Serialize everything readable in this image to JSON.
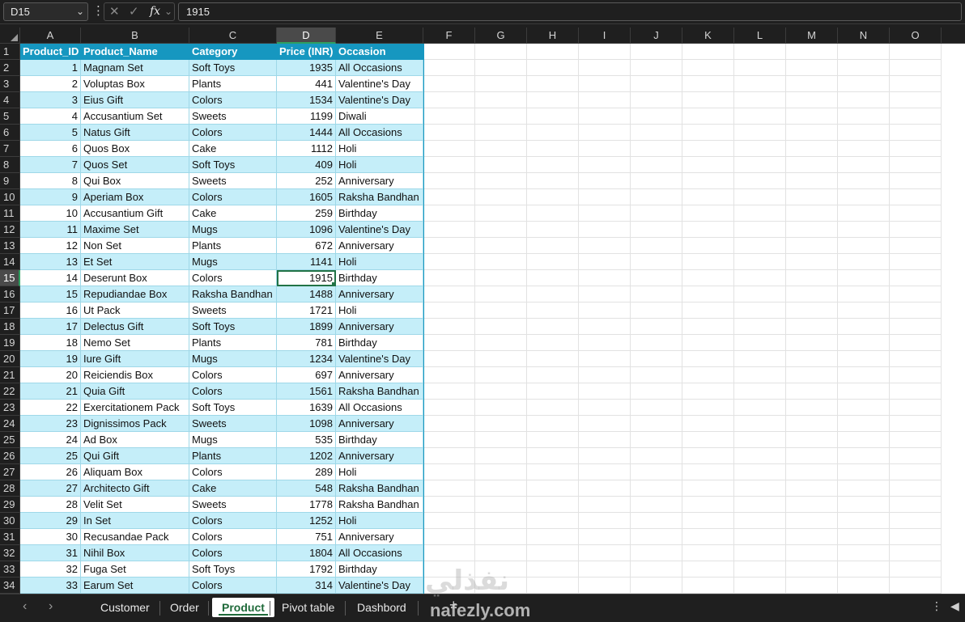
{
  "formula_bar": {
    "name_box": "D15",
    "formula": "1915"
  },
  "columns": [
    "A",
    "B",
    "C",
    "D",
    "E",
    "F",
    "G",
    "H",
    "I",
    "J",
    "K",
    "L",
    "M",
    "N",
    "O"
  ],
  "selected_column": "D",
  "selected_row": 15,
  "table": {
    "headers": [
      "Product_ID",
      "Product_Name",
      "Category",
      "Price (INR)",
      "Occasion"
    ],
    "rows": [
      [
        1,
        "Magnam Set",
        "Soft Toys",
        1935,
        "All Occasions"
      ],
      [
        2,
        "Voluptas Box",
        "Plants",
        441,
        "Valentine's Day"
      ],
      [
        3,
        "Eius Gift",
        "Colors",
        1534,
        "Valentine's Day"
      ],
      [
        4,
        "Accusantium Set",
        "Sweets",
        1199,
        "Diwali"
      ],
      [
        5,
        "Natus Gift",
        "Colors",
        1444,
        "All Occasions"
      ],
      [
        6,
        "Quos Box",
        "Cake",
        1112,
        "Holi"
      ],
      [
        7,
        "Quos Set",
        "Soft Toys",
        409,
        "Holi"
      ],
      [
        8,
        "Qui Box",
        "Sweets",
        252,
        "Anniversary"
      ],
      [
        9,
        "Aperiam Box",
        "Colors",
        1605,
        "Raksha Bandhan"
      ],
      [
        10,
        "Accusantium Gift",
        "Cake",
        259,
        "Birthday"
      ],
      [
        11,
        "Maxime Set",
        "Mugs",
        1096,
        "Valentine's Day"
      ],
      [
        12,
        "Non Set",
        "Plants",
        672,
        "Anniversary"
      ],
      [
        13,
        "Et Set",
        "Mugs",
        1141,
        "Holi"
      ],
      [
        14,
        "Deserunt Box",
        "Colors",
        1915,
        "Birthday"
      ],
      [
        15,
        "Repudiandae Box",
        "Raksha Bandhan",
        1488,
        "Anniversary"
      ],
      [
        16,
        "Ut Pack",
        "Sweets",
        1721,
        "Holi"
      ],
      [
        17,
        "Delectus Gift",
        "Soft Toys",
        1899,
        "Anniversary"
      ],
      [
        18,
        "Nemo Set",
        "Plants",
        781,
        "Birthday"
      ],
      [
        19,
        "Iure Gift",
        "Mugs",
        1234,
        "Valentine's Day"
      ],
      [
        20,
        "Reiciendis Box",
        "Colors",
        697,
        "Anniversary"
      ],
      [
        21,
        "Quia Gift",
        "Colors",
        1561,
        "Raksha Bandhan"
      ],
      [
        22,
        "Exercitationem Pack",
        "Soft Toys",
        1639,
        "All Occasions"
      ],
      [
        23,
        "Dignissimos Pack",
        "Sweets",
        1098,
        "Anniversary"
      ],
      [
        24,
        "Ad Box",
        "Mugs",
        535,
        "Birthday"
      ],
      [
        25,
        "Qui Gift",
        "Plants",
        1202,
        "Anniversary"
      ],
      [
        26,
        "Aliquam Box",
        "Colors",
        289,
        "Holi"
      ],
      [
        27,
        "Architecto Gift",
        "Cake",
        548,
        "Raksha Bandhan"
      ],
      [
        28,
        "Velit Set",
        "Sweets",
        1778,
        "Raksha Bandhan"
      ],
      [
        29,
        "In Set",
        "Colors",
        1252,
        "Holi"
      ],
      [
        30,
        "Recusandae Pack",
        "Colors",
        751,
        "Anniversary"
      ],
      [
        31,
        "Nihil Box",
        "Colors",
        1804,
        "All Occasions"
      ],
      [
        32,
        "Fuga Set",
        "Soft Toys",
        1792,
        "Birthday"
      ],
      [
        33,
        "Earum Set",
        "Colors",
        314,
        "Valentine's Day"
      ]
    ]
  },
  "sheet_tabs": [
    "Customer",
    "Order",
    "Product",
    "Pivot table",
    "Dashbord"
  ],
  "active_tab": "Product",
  "watermark": {
    "arabic": "نفذلي",
    "latin": "nafezly.com"
  },
  "colors": {
    "header_fill": "#1697c0",
    "band_fill": "#c5eef9",
    "selection": "#217346"
  }
}
